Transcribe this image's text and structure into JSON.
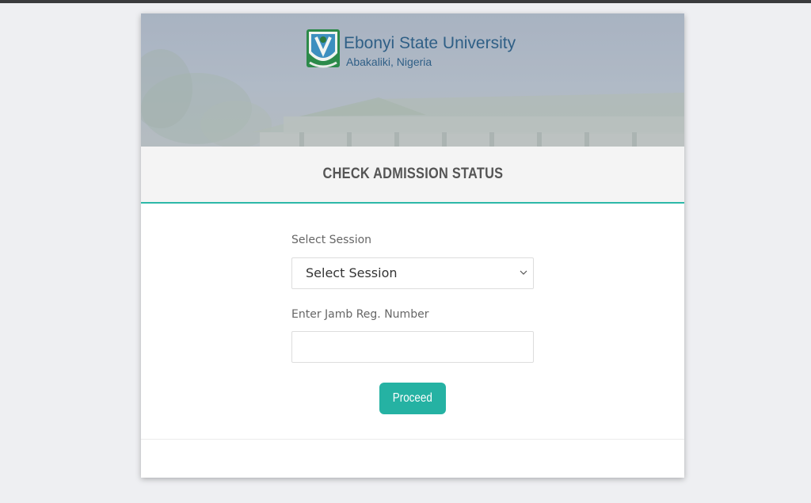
{
  "header": {
    "university_name": "Ebonyi State University",
    "university_location": "Abakaliki, Nigeria",
    "logo_icon": "university-crest-icon"
  },
  "panel": {
    "title": "CHECK ADMISSION STATUS"
  },
  "form": {
    "session_label": "Select Session",
    "session_selected": "Select Session",
    "jamb_label": "Enter Jamb Reg. Number",
    "jamb_value": "",
    "submit_label": "Proceed"
  },
  "colors": {
    "accent": "#25b2a3",
    "title_text": "#555555",
    "brand_text": "#2f5f86"
  }
}
